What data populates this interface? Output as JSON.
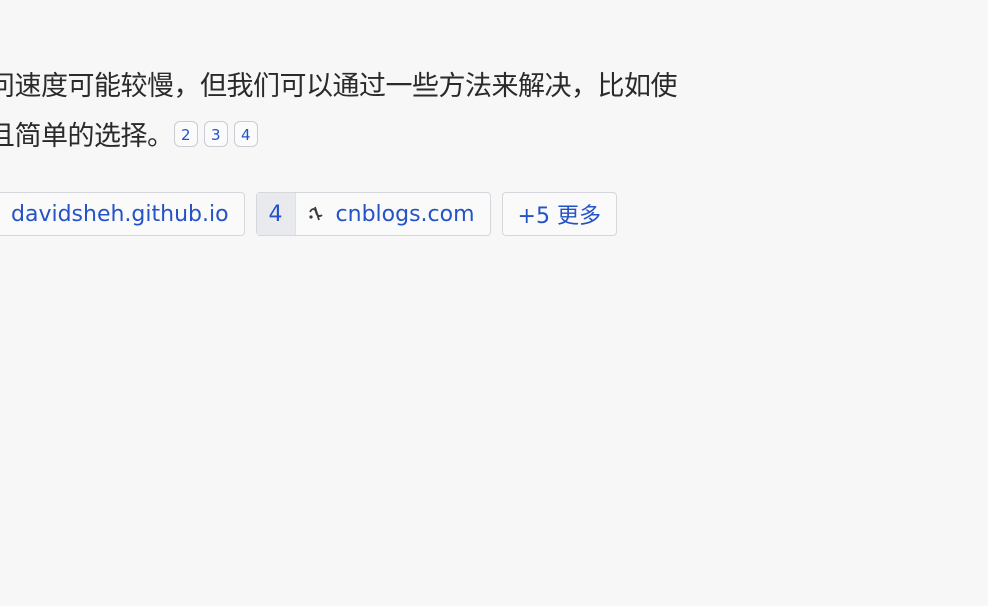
{
  "answer": {
    "line1": "问速度可能较慢，但我们可以通过一些方法来解决，比如使",
    "line2": "且简单的选择。",
    "citations": [
      "2",
      "3",
      "4"
    ]
  },
  "sources": [
    {
      "index": "",
      "domain": "davidsheh.github.io",
      "icon": "globe-icon"
    },
    {
      "index": "4",
      "domain": "cnblogs.com",
      "icon": "cnblogs-icon"
    }
  ],
  "more": {
    "label": "+5 更多"
  },
  "colors": {
    "background": "#f7f7f7",
    "link": "#2452c7",
    "text": "#2a2a2a"
  }
}
